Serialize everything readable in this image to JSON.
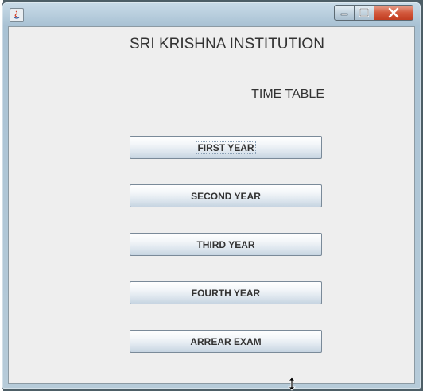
{
  "window": {
    "title": ""
  },
  "header": {
    "institution": "SRI KRISHNA INSTITUTION",
    "section": "TIME TABLE"
  },
  "buttons": {
    "first_year": "FIRST YEAR",
    "second_year": "SECOND YEAR",
    "third_year": "THIRD YEAR",
    "fourth_year": "FOURTH YEAR",
    "arrear_exam": "ARREAR EXAM"
  },
  "icons": {
    "app": "java-app-icon",
    "minimize": "minimize-icon",
    "maximize": "maximize-icon",
    "close": "close-icon",
    "cursor": "resize-cursor-icon"
  },
  "colors": {
    "panel": "#eeeeee",
    "close_button": "#c94a2e",
    "frame": "#b6cbd9"
  }
}
